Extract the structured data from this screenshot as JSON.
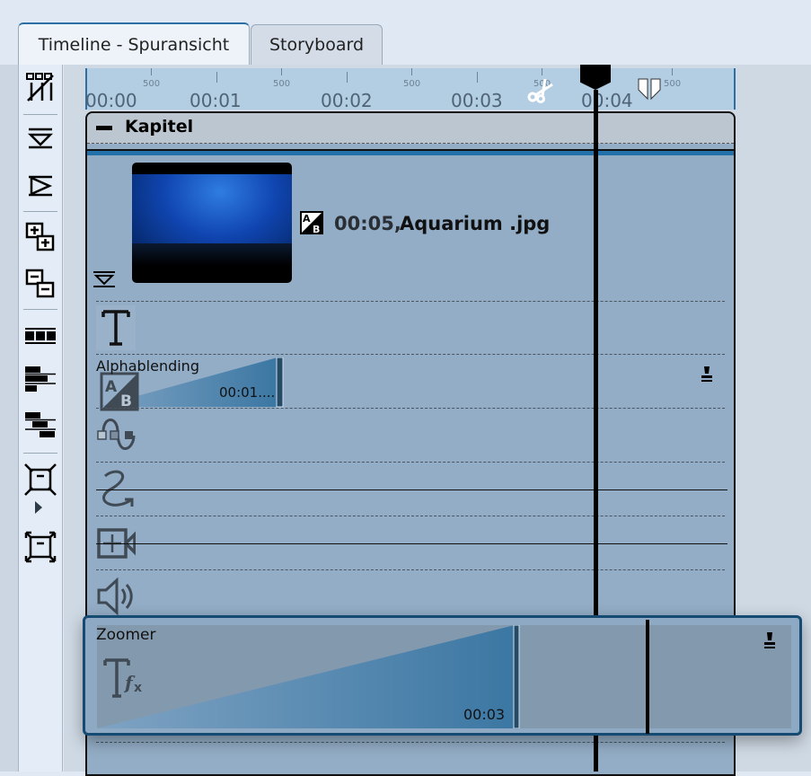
{
  "tabs": [
    {
      "label": "Timeline - Spuransicht",
      "active": true
    },
    {
      "label": "Storyboard",
      "active": false
    }
  ],
  "toolbar": {
    "icons": [
      "split-tracks-icon",
      "collapse-track-icon",
      "expand-track-icon",
      "expand-all-icon",
      "collapse-all-icon",
      "distribute-icon",
      "align-left-icon",
      "align-center-icon",
      "shrink-frame-icon",
      "expand-frame-icon"
    ]
  },
  "ruler": {
    "seconds": [
      "00:00",
      "00:01",
      "00:02",
      "00:03",
      "00:04"
    ],
    "half_label": "500"
  },
  "chapter": {
    "title": "Kapitel",
    "collapse_symbol": "−"
  },
  "image_clip": {
    "duration": "00:05,",
    "name": "Aquarium .jpg"
  },
  "transition": {
    "label": "Alphablending",
    "duration": "00:01...."
  },
  "zoomer": {
    "label": "Zoomer",
    "duration": "00:03"
  },
  "playhead_time_s": 4.2,
  "colors": {
    "accent": "#2271aa",
    "track_bg": "#93adc6",
    "border": "#154a72"
  }
}
